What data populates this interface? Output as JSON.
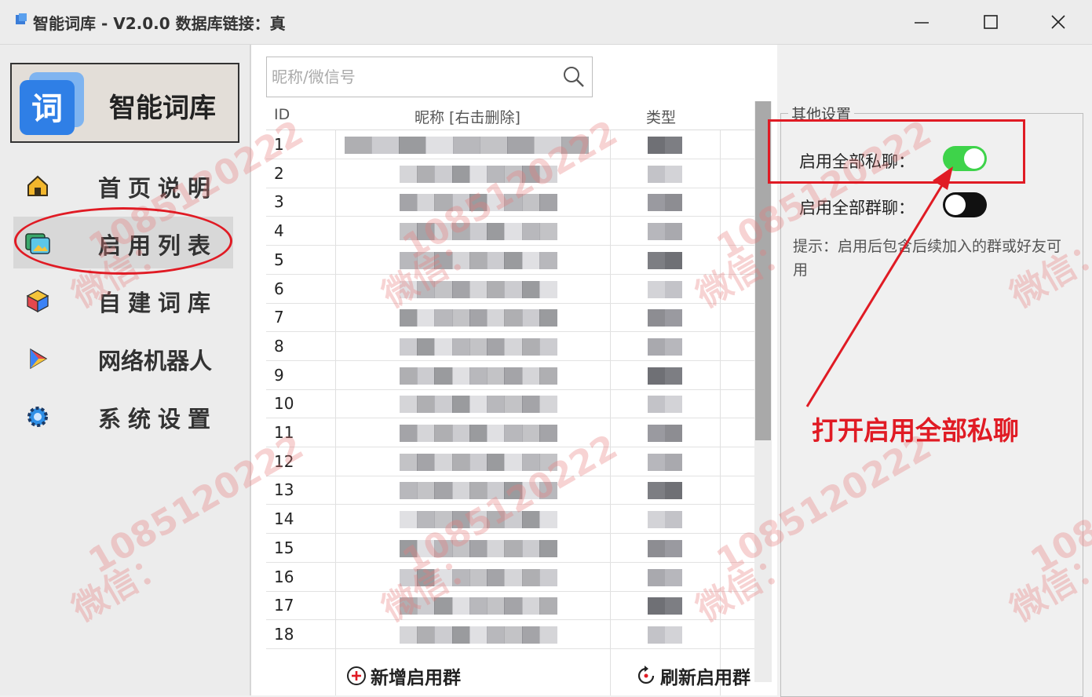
{
  "window": {
    "title": "智能词库 - V2.0.0  数据库链接：真",
    "buttons": {
      "minimize": "minimize-icon",
      "maximize": "maximize-icon",
      "close": "close-icon"
    }
  },
  "sidebar": {
    "brand": {
      "logo_char": "词",
      "name": "智能词库"
    },
    "items": [
      {
        "label": "首页说明",
        "icon": "home-icon",
        "active": false
      },
      {
        "label": "启用列表",
        "icon": "gallery-icon",
        "active": true
      },
      {
        "label": "自建词库",
        "icon": "cube-icon",
        "active": false
      },
      {
        "label": "网络机器人",
        "icon": "play-icon",
        "active": false
      },
      {
        "label": "系统设置",
        "icon": "gear-icon",
        "active": false
      }
    ]
  },
  "search": {
    "placeholder": "昵称/微信号",
    "value": "",
    "icon": "search-icon"
  },
  "table": {
    "columns": [
      "ID",
      "昵称 [右击删除]",
      "类型"
    ],
    "ids": [
      "1",
      "2",
      "3",
      "4",
      "5",
      "6",
      "7",
      "8",
      "9",
      "10",
      "11",
      "12",
      "13",
      "14",
      "15",
      "16",
      "17",
      "18"
    ]
  },
  "actions": {
    "add_label": "新增启用群",
    "add_icon": "plus-circle-icon",
    "refresh_label": "刷新启用群",
    "refresh_icon": "refresh-icon"
  },
  "settings": {
    "group_title": "其他设置",
    "private_label": "启用全部私聊：",
    "private_enabled": true,
    "group_label": "启用全部群聊：",
    "group_enabled": false,
    "hint": "提示：启用后包含后续加入的群或好友可用"
  },
  "annotation": {
    "callout": "打开启用全部私聊",
    "color": "#e01b24"
  },
  "watermark": {
    "number": "1085120222",
    "wechat": "微信："
  },
  "colors": {
    "toggle_on": "#3ed34a",
    "toggle_off": "#111111",
    "annotation_red": "#e01b24"
  }
}
